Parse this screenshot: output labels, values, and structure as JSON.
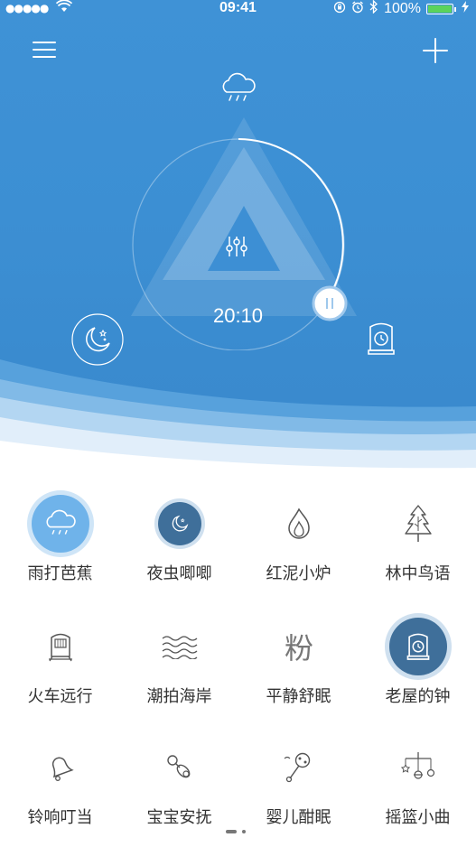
{
  "status_bar": {
    "signal": "●●●●●",
    "time": "09:41",
    "battery": "100%"
  },
  "player": {
    "timer": "20:10",
    "current_scene_icon": "rain-cloud-icon",
    "left_button_icon": "moon-icon",
    "right_button_icon": "clock-icon"
  },
  "sounds": [
    {
      "label": "雨打芭蕉",
      "icon": "rain-cloud-icon",
      "active": true
    },
    {
      "label": "夜虫唧唧",
      "icon": "moon-icon",
      "active": true
    },
    {
      "label": "红泥小炉",
      "icon": "flame-icon",
      "active": false
    },
    {
      "label": "林中鸟语",
      "icon": "pine-tree-icon",
      "active": false
    },
    {
      "label": "火车远行",
      "icon": "train-icon",
      "active": false
    },
    {
      "label": "潮拍海岸",
      "icon": "waves-icon",
      "active": false
    },
    {
      "label": "平静舒眠",
      "icon": "powder-icon",
      "active": false
    },
    {
      "label": "老屋的钟",
      "icon": "clock-icon",
      "active": true
    },
    {
      "label": "铃响叮当",
      "icon": "bell-icon",
      "active": false
    },
    {
      "label": "宝宝安抚",
      "icon": "pacifier-icon",
      "active": false
    },
    {
      "label": "婴儿酣眠",
      "icon": "rattle-icon",
      "active": false
    },
    {
      "label": "摇篮小曲",
      "icon": "mobile-icon",
      "active": false
    }
  ],
  "powder_glyph": "粉",
  "colors": {
    "header_blue": "#3c8fd3",
    "active_light": "#6fb3ea",
    "active_dark": "#3f6f9a",
    "icon_gray": "#555555"
  },
  "pager": {
    "pages": 2,
    "current": 1
  }
}
